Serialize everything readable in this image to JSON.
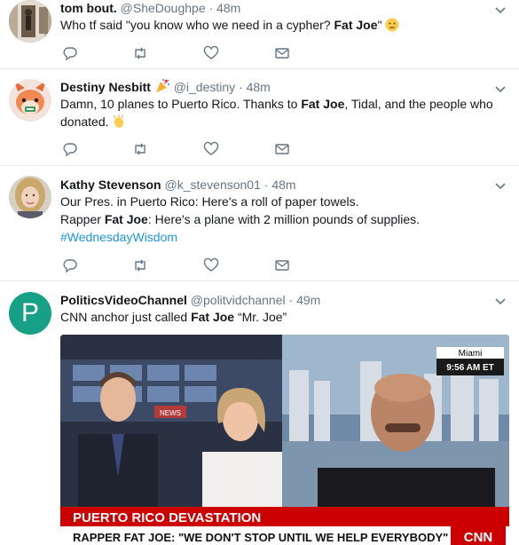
{
  "tweets": [
    {
      "name": "tom bout.",
      "handle": "@SheDoughpe",
      "time": "· 48m",
      "text_pre": "Who tf said \"you know who we need in a cypher? ",
      "text_bold": "Fat Joe",
      "text_post": "\""
    },
    {
      "name": "Destiny Nesbitt",
      "handle": "@i_destiny",
      "time": "· 48m",
      "line1_pre": "Damn, 10 planes to Puerto Rico. Thanks to ",
      "line1_bold": "Fat Joe",
      "line1_post": ", Tidal, and the people who",
      "line2": "donated."
    },
    {
      "name": "Kathy Stevenson",
      "handle": "@k_stevenson01",
      "time": "· 48m",
      "line1": "Our Pres. in Puerto Rico: Here's a roll of paper towels.",
      "line2_pre": "Rapper ",
      "line2_bold": "Fat Joe",
      "line2_post": ": Here's a plane with 2 million pounds of supplies.",
      "hashtag": "#WednesdayWisdom"
    },
    {
      "name": "PoliticsVideoChannel",
      "handle": "@politvidchannel",
      "time": "· 49m",
      "avatar_letter": "P",
      "text_pre": "CNN anchor just called ",
      "text_bold": "Fat Joe",
      "text_post": " “Mr. Joe”"
    }
  ],
  "video": {
    "location": "Miami",
    "clock": "9:56 AM ET",
    "banner_title": "PUERTO RICO DEVASTATION",
    "banner_sub": "RAPPER FAT JOE: \"WE DON'T STOP UNTIL WE HELP EVERYBODY\"",
    "logo": "CNN",
    "wall_sign": "NEWS"
  },
  "icons": {
    "reply": "reply-icon",
    "retweet": "retweet-icon",
    "like": "heart-icon",
    "dm": "envelope-icon",
    "menu": "chevron-down-icon"
  },
  "colors": {
    "text": "#14171a",
    "secondary": "#657786",
    "link": "#1b95e0",
    "divider": "#e6ecf0",
    "avatar_p": "#16a085",
    "cnn_red": "#cc0000"
  }
}
